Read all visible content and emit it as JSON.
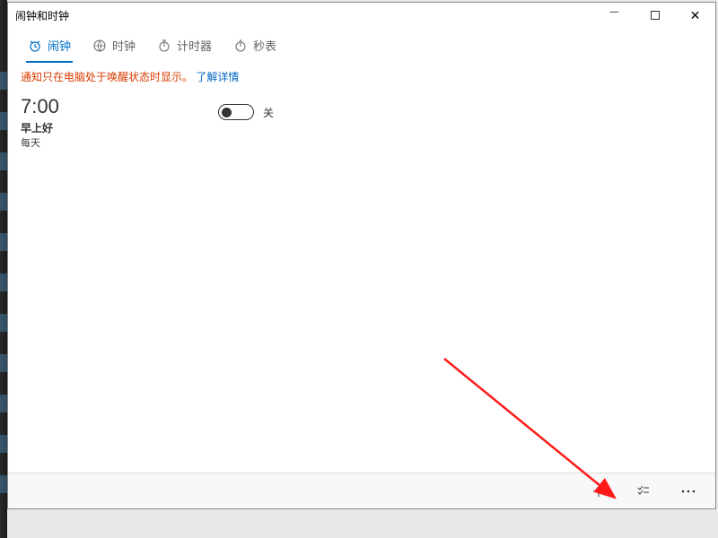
{
  "window": {
    "title": "闹钟和时钟"
  },
  "tabs": [
    {
      "id": "alarm",
      "label": "闹钟",
      "active": true
    },
    {
      "id": "clock",
      "label": "时钟",
      "active": false
    },
    {
      "id": "timer",
      "label": "计时器",
      "active": false
    },
    {
      "id": "stopwatch",
      "label": "秒表",
      "active": false
    }
  ],
  "notice": {
    "text": "通知只在电脑处于唤醒状态时显示。",
    "link": "了解详情"
  },
  "alarms": [
    {
      "time": "7:00",
      "title": "早上好",
      "repeat": "每天",
      "enabled": false,
      "toggle_label": "关"
    }
  ],
  "bottombar": {
    "add": "+",
    "select": "☰",
    "more": "⋯"
  }
}
